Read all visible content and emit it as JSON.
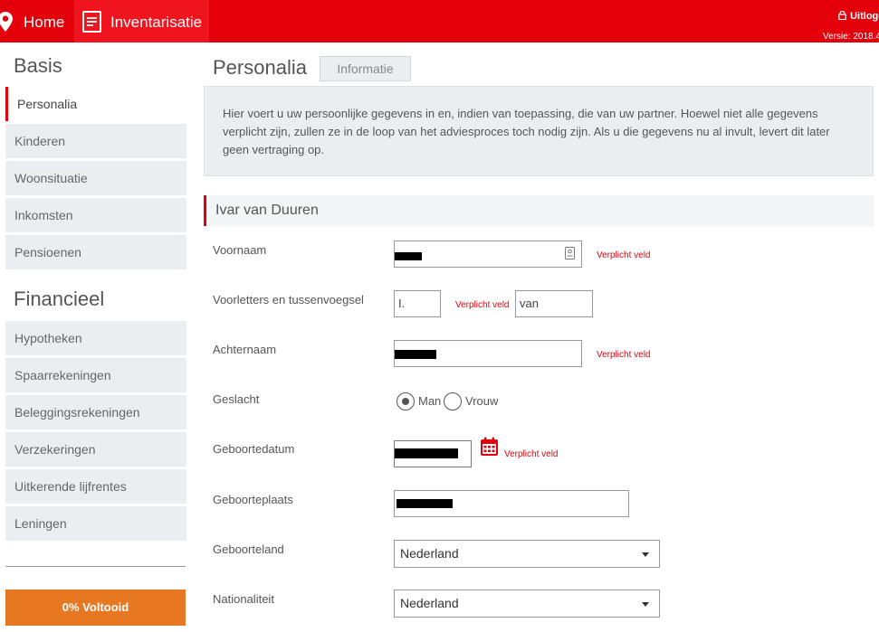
{
  "topbar": {
    "home_label": "Home",
    "inventarisatie_label": "Inventarisatie",
    "logout_label": "Uitlogg",
    "version": "Versie: 2018.4"
  },
  "sidebar": {
    "basis_heading": "Basis",
    "basis_items": [
      "Personalia",
      "Kinderen",
      "Woonsituatie",
      "Inkomsten",
      "Pensioenen"
    ],
    "financieel_heading": "Financieel",
    "financieel_items": [
      "Hypotheken",
      "Spaarrekeningen",
      "Beleggingsrekeningen",
      "Verzekeringen",
      "Uitkerende lijfrentes",
      "Leningen"
    ],
    "progress_label": "0% Voltooid"
  },
  "main": {
    "title": "Personalia",
    "info_button": "Informatie",
    "intro_text": "Hier voert u uw persoonlijke gegevens in en, indien van toepassing, die van uw partner. Hoewel niet alle gegevens verplicht zijn, zullen ze in de loop van het adviesproces toch nodig zijn. Als u die gegevens nu al invult, levert dit later geen vertraging op.",
    "person_name": "Ivar van Duuren"
  },
  "form": {
    "required_text": "Verplicht veld",
    "voornaam_label": "Voornaam",
    "voorletters_label": "Voorletters en tussenvoegsel",
    "voorletters_value": "I.",
    "tussenvoegsel_value": "van",
    "achternaam_label": "Achternaam",
    "geslacht_label": "Geslacht",
    "gender_man": "Man",
    "gender_vrouw": "Vrouw",
    "gender_selected": "Man",
    "geboortedatum_label": "Geboortedatum",
    "geboorteplaats_label": "Geboorteplaats",
    "geboorteland_label": "Geboorteland",
    "geboorteland_value": "Nederland",
    "nationaliteit_label": "Nationaliteit",
    "nationaliteit_value": "Nederland"
  },
  "colors": {
    "brand_red": "#e3000b",
    "progress_orange": "#e87722",
    "panel_grey": "#ebeef0"
  },
  "icons": [
    "location-pin-icon",
    "document-icon",
    "lock-icon",
    "id-card-icon",
    "calendar-icon",
    "chevron-down-icon"
  ]
}
